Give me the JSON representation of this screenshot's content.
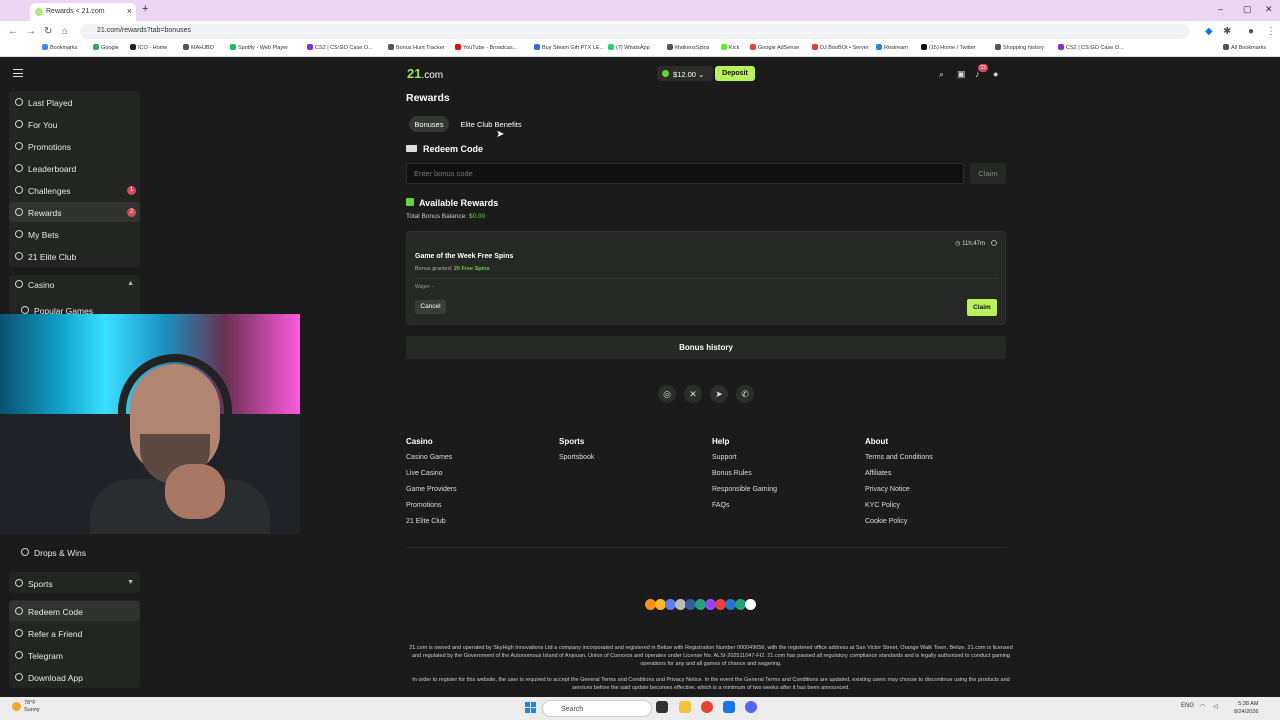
{
  "browser": {
    "tab_title": "Rewards < 21.com",
    "url": "21.com/rewards?tab=bonuses",
    "bookmarks": [
      "Bookmarks",
      "Google",
      "ICO - Home",
      "MAHJBO",
      "Spotify - Web Player",
      "CS2 | CS:GO Case O...",
      "Bonus Hunt Tracker",
      "YouTube - Broadcas...",
      "Buy Steam Gift PTX LE...",
      "(7) WhatsApp",
      "MatkensSpins",
      "Kick",
      "Google AdSense",
      "DJ BooBOt • Server",
      "Restream",
      "(15) Home / Twitter",
      "Shopping history",
      "CS2 | CS:GO Case O...",
      "All Bookmarks"
    ]
  },
  "header": {
    "logo": "21",
    "logo_suffix": ".com",
    "balance": "$12.00",
    "deposit": "Deposit",
    "notif_count": "22"
  },
  "sidebar": {
    "items": [
      {
        "label": "Last Played",
        "badge": ""
      },
      {
        "label": "For You",
        "badge": ""
      },
      {
        "label": "Promotions",
        "badge": ""
      },
      {
        "label": "Leaderboard",
        "badge": ""
      },
      {
        "label": "Challenges",
        "badge": "1"
      },
      {
        "label": "Rewards",
        "badge": "2"
      },
      {
        "label": "My Bets",
        "badge": ""
      },
      {
        "label": "21 Elite Club",
        "badge": ""
      }
    ],
    "casino": "Casino",
    "popular_games": "Popular Games",
    "drops_wins": "Drops & Wins",
    "sports": "Sports",
    "bottom": [
      "Redeem Code",
      "Refer a Friend",
      "Telegram",
      "Download App"
    ]
  },
  "main": {
    "title": "Rewards",
    "tabs": [
      "Bonuses",
      "Elite Club Benefits"
    ],
    "redeem_title": "Redeem Code",
    "code_placeholder": "Enter bonus code",
    "claim": "Claim",
    "available_title": "Available Rewards",
    "total_label": "Total Bonus Balance:",
    "total_value": "$0.00",
    "card": {
      "title": "Game of the Week Free Spins",
      "granted_label": "Bonus granted:",
      "granted_value": "20 Free Spins",
      "timer": "11h:47m",
      "wager": "Wager: -",
      "cancel": "Cancel",
      "claim": "Claim"
    },
    "bonus_history": "Bonus history"
  },
  "footer": {
    "socials": [
      "instagram-icon",
      "x-icon",
      "telegram-icon",
      "whatsapp-icon"
    ],
    "columns": [
      {
        "head": "Casino",
        "links": [
          "Casino Games",
          "Live Casino",
          "Game Providers",
          "Promotions",
          "21 Elite Club"
        ]
      },
      {
        "head": "Sports",
        "links": [
          "Sportsbook"
        ]
      },
      {
        "head": "Help",
        "links": [
          "Support",
          "Bonus Rules",
          "Responsible Gaming",
          "FAQs"
        ]
      },
      {
        "head": "About",
        "links": [
          "Terms and Conditions",
          "Affiliates",
          "Privacy Notice",
          "KYC Policy",
          "Cookie Policy"
        ]
      }
    ],
    "crypto_colors": [
      "#f7931a",
      "#f3ba2f",
      "#627eea",
      "#bfbbbb",
      "#345d9d",
      "#26a17b",
      "#9945ff",
      "#e84142",
      "#2775ca",
      "#26a17b",
      "#ffffff"
    ],
    "legal_1": "21.com is owned and operated by SkyHigh Innovations Ltd a company incorporated and registered in Belize with Registration Number 000049656, with the registered office address at San Victor Street, Orange Walk Town, Belize. 21.com is licensed and regulated by the Government of the Autonomous Island of Anjouan, Union of Comoros and operates under License No. ALSI-202511047-FI2. 21.com has passed all regulatory compliance standards and is legally authorized to conduct gaming operations for any and all games of chance and wagering.",
    "legal_2": "In order to register for this website, the user is required to accept the General Terms and Conditions and Privacy Notice. In the event the General Terms and Conditions are updated, existing users may choose to discontinue using the products and services before the said update becomes effective, which is a minimum of two weeks after it has been announced."
  },
  "taskbar": {
    "temp": "78°F",
    "weather": "Sunny",
    "search": "Search",
    "lang": "ENG",
    "time": "5:38 AM",
    "date": "8/24/2026"
  }
}
